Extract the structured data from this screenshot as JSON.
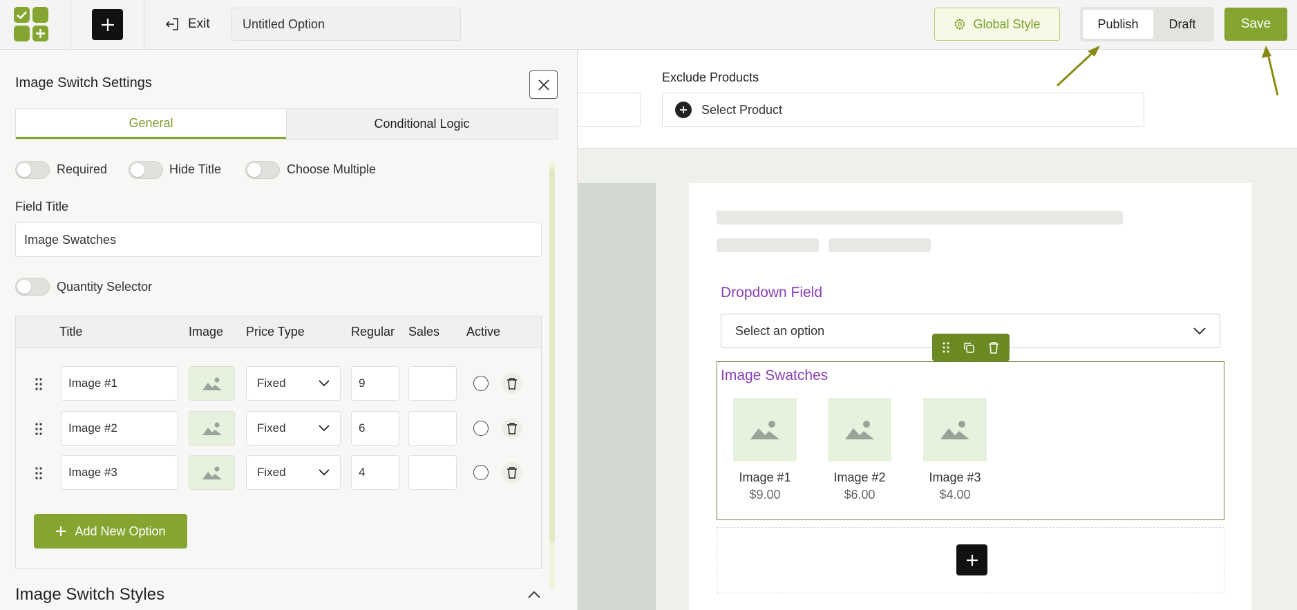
{
  "header": {
    "exit_label": "Exit",
    "option_title": "Untitled Option",
    "global_style_label": "Global Style",
    "publish_label": "Publish",
    "draft_label": "Draft",
    "save_label": "Save"
  },
  "panel": {
    "title": "Image Switch Settings",
    "tabs": [
      {
        "label": "General",
        "active": true
      },
      {
        "label": "Conditional Logic",
        "active": false
      }
    ],
    "toggles": {
      "required": "Required",
      "hide_title": "Hide Title",
      "choose_multiple": "Choose Multiple",
      "quantity_selector": "Quantity Selector"
    },
    "field_title_label": "Field Title",
    "field_title_value": "Image Swatches",
    "table": {
      "headers": [
        "Title",
        "Image",
        "Price Type",
        "Regular",
        "Sales",
        "Active"
      ],
      "rows": [
        {
          "title": "Image #1",
          "price_type": "Fixed",
          "regular": "9",
          "sales": ""
        },
        {
          "title": "Image #2",
          "price_type": "Fixed",
          "regular": "6",
          "sales": ""
        },
        {
          "title": "Image #3",
          "price_type": "Fixed",
          "regular": "4",
          "sales": ""
        }
      ],
      "add_label": "Add New Option"
    },
    "styles_heading": "Image Switch Styles"
  },
  "canvas": {
    "exclude_label": "Exclude Products",
    "exclude_placeholder": "Select Product",
    "dropdown_label": "Dropdown Field",
    "dropdown_placeholder": "Select an option",
    "swatches_title": "Image Swatches",
    "swatches": [
      {
        "name": "Image #1",
        "price": "$9.00"
      },
      {
        "name": "Image #2",
        "price": "$6.00"
      },
      {
        "name": "Image #3",
        "price": "$4.00"
      }
    ]
  },
  "colors": {
    "accent": "#84a630",
    "label_purple": "#8b3fb5",
    "annotation_arrow": "#8a8a12"
  }
}
